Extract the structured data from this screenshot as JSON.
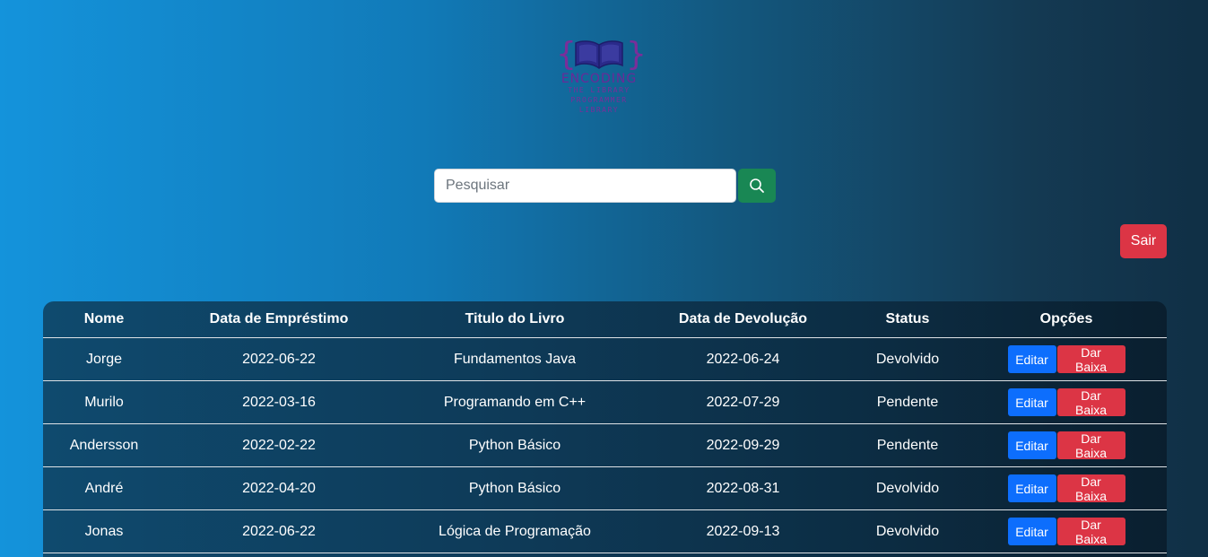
{
  "logo": {
    "word": "ENCODING",
    "sub1": "THE LIBRARY PROGRAMMER",
    "sub2": "LIBRARY",
    "colors": {
      "book": "#2a2a8a",
      "braces": "#7a2e9a"
    }
  },
  "search": {
    "placeholder": "Pesquisar",
    "value": "",
    "icon": "search-icon"
  },
  "logout_label": "Sair",
  "table": {
    "headers": [
      "Nome",
      "Data de Empréstimo",
      "Titulo do Livro",
      "Data de Devolução",
      "Status",
      "Opções"
    ],
    "rows": [
      {
        "nome": "Jorge",
        "emprestimo": "2022-06-22",
        "titulo": "Fundamentos Java",
        "devolucao": "2022-06-24",
        "status": "Devolvido",
        "edit": "Editar",
        "baixa": "Dar Baixa"
      },
      {
        "nome": "Murilo",
        "emprestimo": "2022-03-16",
        "titulo": "Programando em C++",
        "devolucao": "2022-07-29",
        "status": "Pendente",
        "edit": "Editar",
        "baixa": "Dar Baixa"
      },
      {
        "nome": "Andersson",
        "emprestimo": "2022-02-22",
        "titulo": "Python Básico",
        "devolucao": "2022-09-29",
        "status": "Pendente",
        "edit": "Editar",
        "baixa": "Dar Baixa"
      },
      {
        "nome": "André",
        "emprestimo": "2022-04-20",
        "titulo": "Python Básico",
        "devolucao": "2022-08-31",
        "status": "Devolvido",
        "edit": "Editar",
        "baixa": "Dar Baixa"
      },
      {
        "nome": "Jonas",
        "emprestimo": "2022-06-22",
        "titulo": "Lógica de Programação",
        "devolucao": "2022-09-13",
        "status": "Devolvido",
        "edit": "Editar",
        "baixa": "Dar Baixa"
      }
    ]
  },
  "colors": {
    "search_button": "#198754",
    "logout_button": "#dc3545",
    "edit_button": "#0d6efd",
    "baixa_button": "#dc3545"
  }
}
